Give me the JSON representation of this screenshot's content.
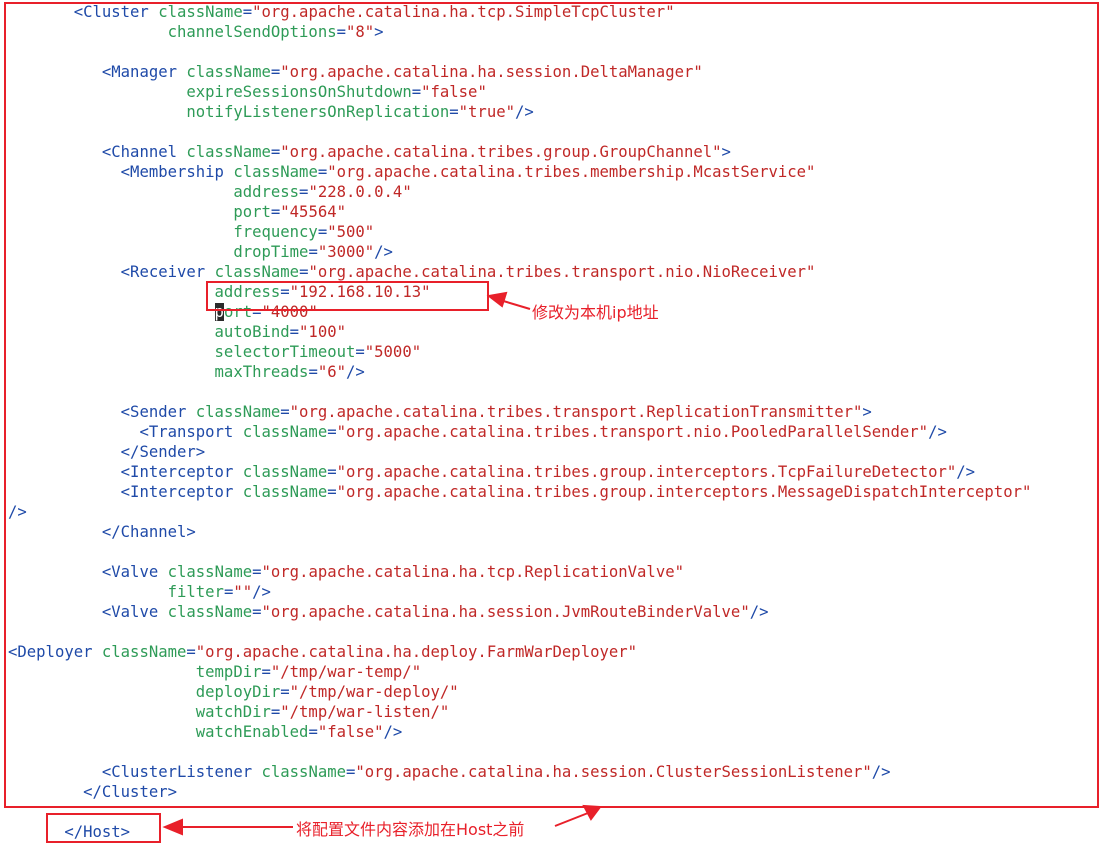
{
  "annotations": {
    "receiver_note": "修改为本机ip地址",
    "host_note": "将配置文件内容添加在Host之前",
    "color": "#e8202a"
  },
  "code": {
    "l0": {
      "indent": "       ",
      "tag": "<Cluster",
      "a1": "className",
      "v1": "\"org.apache.catalina.ha.tcp.SimpleTcpCluster\""
    },
    "l1": {
      "indent": "                 ",
      "a1": "channelSendOptions",
      "v1": "\"8\"",
      "end": ">"
    },
    "l3": {
      "indent": "          ",
      "tag": "<Manager",
      "a1": "className",
      "v1": "\"org.apache.catalina.ha.session.DeltaManager\""
    },
    "l4": {
      "indent": "                   ",
      "a1": "expireSessionsOnShutdown",
      "v1": "\"false\""
    },
    "l5": {
      "indent": "                   ",
      "a1": "notifyListenersOnReplication",
      "v1": "\"true\"",
      "end": "/>"
    },
    "l7": {
      "indent": "          ",
      "tag": "<Channel",
      "a1": "className",
      "v1": "\"org.apache.catalina.tribes.group.GroupChannel\"",
      "end": ">"
    },
    "l8": {
      "indent": "            ",
      "tag": "<Membership",
      "a1": "className",
      "v1": "\"org.apache.catalina.tribes.membership.McastService\""
    },
    "l9": {
      "indent": "                        ",
      "a1": "address",
      "v1": "\"228.0.0.4\""
    },
    "l10": {
      "indent": "                        ",
      "a1": "port",
      "v1": "\"45564\""
    },
    "l11": {
      "indent": "                        ",
      "a1": "frequency",
      "v1": "\"500\""
    },
    "l12": {
      "indent": "                        ",
      "a1": "dropTime",
      "v1": "\"3000\"",
      "end": "/>"
    },
    "l13": {
      "indent": "            ",
      "tag": "<Receiver",
      "a1": "className",
      "v1": "\"org.apache.catalina.tribes.transport.nio.NioReceiver\""
    },
    "l14": {
      "indent": "                      ",
      "a1": "address",
      "v1": "\"192.168.10.13\""
    },
    "l15": {
      "indent": "                      ",
      "cursor": "p",
      "a1": "ort",
      "v1": "\"4000\""
    },
    "l16": {
      "indent": "                      ",
      "a1": "autoBind",
      "v1": "\"100\""
    },
    "l17": {
      "indent": "                      ",
      "a1": "selectorTimeout",
      "v1": "\"5000\""
    },
    "l18": {
      "indent": "                      ",
      "a1": "maxThreads",
      "v1": "\"6\"",
      "end": "/>"
    },
    "l20": {
      "indent": "            ",
      "tag": "<Sender",
      "a1": "className",
      "v1": "\"org.apache.catalina.tribes.transport.ReplicationTransmitter\"",
      "end": ">"
    },
    "l21": {
      "indent": "              ",
      "tag": "<Transport",
      "a1": "className",
      "v1": "\"org.apache.catalina.tribes.transport.nio.PooledParallelSender\"",
      "end": "/>"
    },
    "l22": {
      "indent": "            ",
      "tag": "</Sender>"
    },
    "l23": {
      "indent": "            ",
      "tag": "<Interceptor",
      "a1": "className",
      "v1": "\"org.apache.catalina.tribes.group.interceptors.TcpFailureDetector\"",
      "end": "/>"
    },
    "l24": {
      "indent": "            ",
      "tag": "<Interceptor",
      "a1": "className",
      "v1": "\"org.apache.catalina.tribes.group.interceptors.MessageDispatchInterceptor\""
    },
    "l25": {
      "indent": "",
      "end": "/>"
    },
    "l26": {
      "indent": "          ",
      "tag": "</Channel>"
    },
    "l28": {
      "indent": "          ",
      "tag": "<Valve",
      "a1": "className",
      "v1": "\"org.apache.catalina.ha.tcp.ReplicationValve\""
    },
    "l29": {
      "indent": "                 ",
      "a1": "filter",
      "v1": "\"\"",
      "end": "/>"
    },
    "l30": {
      "indent": "          ",
      "tag": "<Valve",
      "a1": "className",
      "v1": "\"org.apache.catalina.ha.session.JvmRouteBinderValve\"",
      "end": "/>"
    },
    "l32": {
      "indent": "",
      "tag": "<Deployer",
      "a1": "className",
      "v1": "\"org.apache.catalina.ha.deploy.FarmWarDeployer\""
    },
    "l33": {
      "indent": "                    ",
      "a1": "tempDir",
      "v1": "\"/tmp/war-temp/\""
    },
    "l34": {
      "indent": "                    ",
      "a1": "deployDir",
      "v1": "\"/tmp/war-deploy/\""
    },
    "l35": {
      "indent": "                    ",
      "a1": "watchDir",
      "v1": "\"/tmp/war-listen/\""
    },
    "l36": {
      "indent": "                    ",
      "a1": "watchEnabled",
      "v1": "\"false\"",
      "end": "/>"
    },
    "l38": {
      "indent": "          ",
      "tag": "<ClusterListener",
      "a1": "className",
      "v1": "\"org.apache.catalina.ha.session.ClusterSessionListener\"",
      "end": "/>"
    },
    "l39": {
      "indent": "        ",
      "tag": "</Cluster>"
    },
    "l41": {
      "indent": "      ",
      "tag": "</Host>"
    }
  }
}
